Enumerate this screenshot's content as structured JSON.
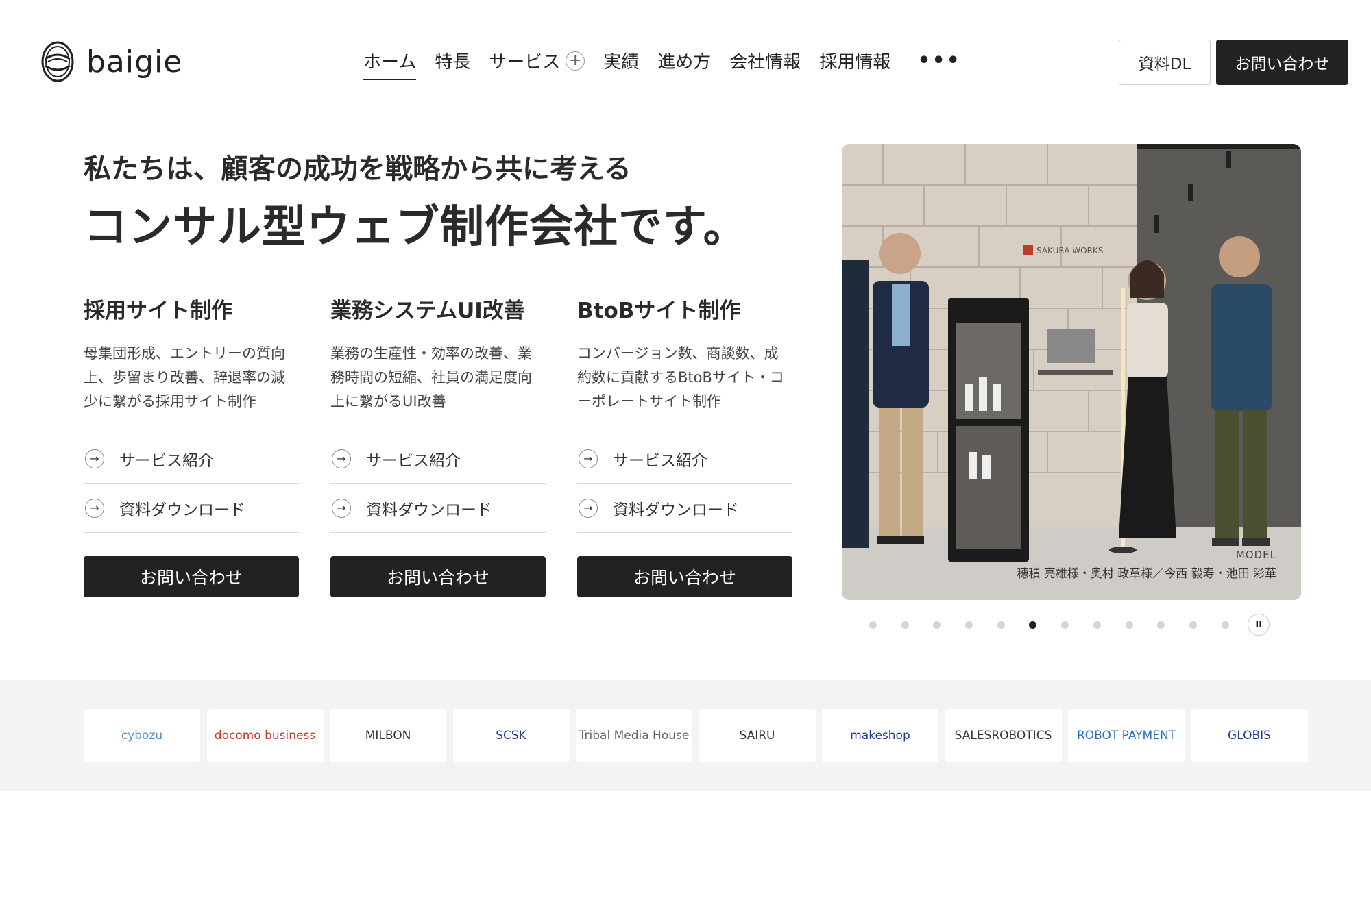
{
  "brand": {
    "name": "baigie"
  },
  "nav": {
    "items": [
      {
        "label": "ホーム",
        "active": true
      },
      {
        "label": "特長"
      },
      {
        "label": "サービス",
        "expandable": true
      },
      {
        "label": "実績"
      },
      {
        "label": "進め方"
      },
      {
        "label": "会社情報"
      },
      {
        "label": "採用情報"
      }
    ],
    "more": "•••",
    "plus": "+"
  },
  "header_buttons": {
    "download": "資料DL",
    "contact": "お問い合わせ"
  },
  "hero": {
    "subtitle": "私たちは、顧客の成功を戦略から共に考える",
    "title": "コンサル型ウェブ制作会社です。"
  },
  "services": [
    {
      "title": "採用サイト制作",
      "description": "母集団形成、エントリーの質向上、歩留まり改善、辞退率の減少に繋がる採用サイト制作",
      "links": [
        "サービス紹介",
        "資料ダウンロード"
      ],
      "button": "お問い合わせ"
    },
    {
      "title": "業務システムUI改善",
      "description": "業務の生産性・効率の改善、業務時間の短縮、社員の満足度向上に繋がるUI改善",
      "links": [
        "サービス紹介",
        "資料ダウンロード"
      ],
      "button": "お問い合わせ"
    },
    {
      "title": "BtoBサイト制作",
      "description": "コンバージョン数、商談数、成約数に貢献するBtoBサイト・コーポレートサイト制作",
      "links": [
        "サービス紹介",
        "資料ダウンロード"
      ],
      "button": "お問い合わせ"
    }
  ],
  "hero_image": {
    "sign_text": "SAKURA WORKS",
    "caption_label": "MODEL",
    "caption_names": "穂積 亮雄様・奥村 政章様／今西 毅寿・池田 彩華"
  },
  "carousel": {
    "slide_count": 12,
    "active_index": 5,
    "pause": "II"
  },
  "client_logos": [
    "cybozu",
    "docomo business",
    "MILBON",
    "SCSK",
    "Tribal Media House",
    "SAIRU",
    "makeshop",
    "SALESROBOTICS",
    "ROBOT PAYMENT",
    "GLOBIS"
  ],
  "colors": {
    "text": "#222222",
    "button_dark": "#222222",
    "band": "#f3f3f3"
  }
}
